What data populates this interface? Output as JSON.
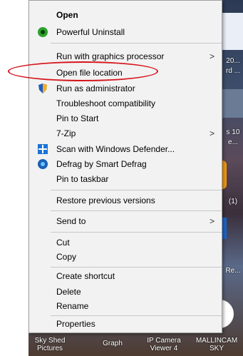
{
  "menu": {
    "items": [
      {
        "label": "Open",
        "bold": true
      },
      {
        "label": "Powerful Uninstall"
      },
      {
        "label": "Run with graphics processor",
        "submenu": true
      },
      {
        "label": "Open file location"
      },
      {
        "label": "Run as administrator"
      },
      {
        "label": "Troubleshoot compatibility"
      },
      {
        "label": "Pin to Start"
      },
      {
        "label": "7-Zip",
        "submenu": true
      },
      {
        "label": "Scan with Windows Defender..."
      },
      {
        "label": "Defrag by Smart Defrag"
      },
      {
        "label": "Pin to taskbar"
      },
      {
        "label": "Restore previous versions"
      },
      {
        "label": "Send to",
        "submenu": true
      },
      {
        "label": "Cut"
      },
      {
        "label": "Copy"
      },
      {
        "label": "Create shortcut"
      },
      {
        "label": "Delete"
      },
      {
        "label": "Rename"
      },
      {
        "label": "Properties"
      }
    ],
    "submenu_arrow": ">"
  },
  "desktop": {
    "right_edge_labels": [
      "20...",
      "rd ...",
      "s 10",
      "e...",
      "(1)",
      "Re..."
    ],
    "bottom_labels": [
      "Sky Shed\nPictures",
      "Graph",
      "IP Camera\nViewer 4",
      "MALLINCAM\nSKY"
    ]
  },
  "colors": {
    "menu_bg": "#f2f2f2",
    "highlight_ring": "#d6161d"
  }
}
